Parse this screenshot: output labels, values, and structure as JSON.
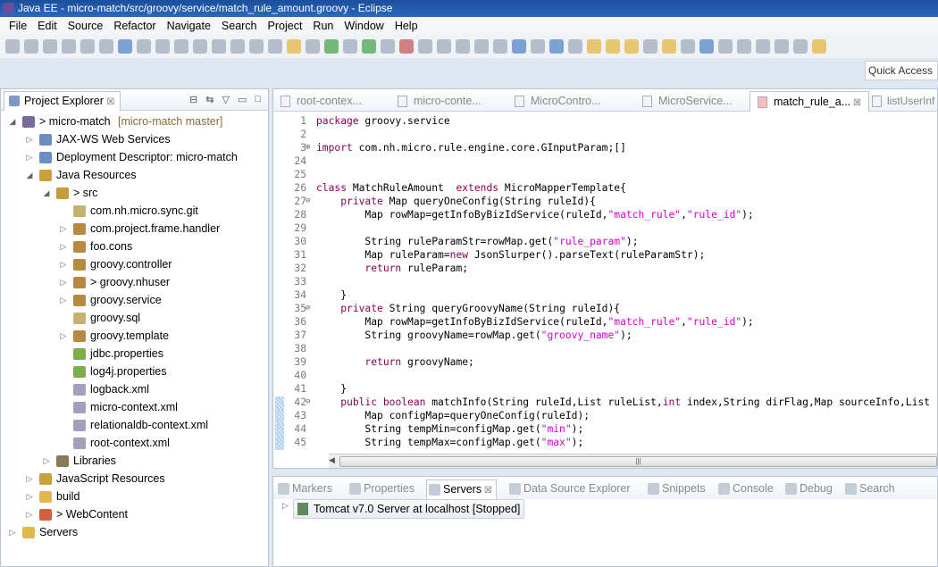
{
  "window_title": "Java EE - micro-match/src/groovy/service/match_rule_amount.groovy - Eclipse",
  "menu": [
    "File",
    "Edit",
    "Source",
    "Refactor",
    "Navigate",
    "Search",
    "Project",
    "Run",
    "Window",
    "Help"
  ],
  "quick_access": "Quick Access",
  "project_explorer": {
    "tab_label": "Project Explorer",
    "tree": [
      {
        "level": 0,
        "expanded": true,
        "label": "> micro-match",
        "decoration": "[micro-match master]",
        "icon": "project-icon",
        "color": "#7a6a9a"
      },
      {
        "level": 1,
        "expanded": false,
        "label": "JAX-WS Web Services",
        "icon": "webservice-icon",
        "color": "#6a8ec2"
      },
      {
        "level": 1,
        "expanded": false,
        "label": "Deployment Descriptor: micro-match",
        "icon": "descriptor-icon",
        "color": "#6a8ec2"
      },
      {
        "level": 1,
        "expanded": true,
        "label": "Java Resources",
        "icon": "java-resources-icon",
        "color": "#c8a040"
      },
      {
        "level": 2,
        "expanded": true,
        "label": "> src",
        "icon": "source-folder-icon",
        "color": "#c89a40"
      },
      {
        "level": 3,
        "expanded": null,
        "label": "com.nh.micro.sync.git",
        "icon": "package-icon",
        "color": "#c8b070"
      },
      {
        "level": 3,
        "expanded": false,
        "label": "com.project.frame.handler",
        "icon": "package-icon",
        "color": "#b88a40"
      },
      {
        "level": 3,
        "expanded": false,
        "label": "foo.cons",
        "icon": "package-icon",
        "color": "#b88a40"
      },
      {
        "level": 3,
        "expanded": false,
        "label": "groovy.controller",
        "icon": "package-icon",
        "color": "#b88a40"
      },
      {
        "level": 3,
        "expanded": false,
        "label": "> groovy.nhuser",
        "icon": "package-icon",
        "color": "#b88a40"
      },
      {
        "level": 3,
        "expanded": false,
        "label": "groovy.service",
        "icon": "package-icon",
        "color": "#b88a40"
      },
      {
        "level": 3,
        "expanded": null,
        "label": "groovy.sql",
        "icon": "package-icon",
        "color": "#c8b070"
      },
      {
        "level": 3,
        "expanded": false,
        "label": "groovy.template",
        "icon": "package-icon",
        "color": "#b88a40"
      },
      {
        "level": 3,
        "expanded": null,
        "label": "jdbc.properties",
        "icon": "properties-file-icon",
        "color": "#7ab04a"
      },
      {
        "level": 3,
        "expanded": null,
        "label": "log4j.properties",
        "icon": "properties-file-icon",
        "color": "#7ab04a"
      },
      {
        "level": 3,
        "expanded": null,
        "label": "logback.xml",
        "icon": "xml-file-icon",
        "color": "#a0a0b8"
      },
      {
        "level": 3,
        "expanded": null,
        "label": "micro-context.xml",
        "icon": "xml-file-icon",
        "color": "#a0a0b8"
      },
      {
        "level": 3,
        "expanded": null,
        "label": "relationaldb-context.xml",
        "icon": "xml-file-icon",
        "color": "#a0a0b8"
      },
      {
        "level": 3,
        "expanded": null,
        "label": "root-context.xml",
        "icon": "xml-file-icon",
        "color": "#a0a0b8"
      },
      {
        "level": 2,
        "expanded": false,
        "label": "Libraries",
        "icon": "libraries-icon",
        "color": "#8a7a5a"
      },
      {
        "level": 1,
        "expanded": false,
        "label": "JavaScript Resources",
        "icon": "js-resources-icon",
        "color": "#c8a040"
      },
      {
        "level": 1,
        "expanded": false,
        "label": "build",
        "icon": "folder-icon",
        "color": "#e0b850"
      },
      {
        "level": 1,
        "expanded": false,
        "label": "> WebContent",
        "icon": "webcontent-folder-icon",
        "color": "#d06040"
      },
      {
        "level": 0,
        "expanded": false,
        "label": "Servers",
        "icon": "folder-icon",
        "color": "#e0b850"
      }
    ]
  },
  "editor": {
    "tabs": [
      {
        "label": "root-contex...",
        "active": false
      },
      {
        "label": "micro-conte...",
        "active": false
      },
      {
        "label": "MicroContro...",
        "active": false
      },
      {
        "label": "MicroService...",
        "active": false
      },
      {
        "label": "match_rule_a...",
        "active": true
      },
      {
        "label": "listUserInf",
        "active": false
      }
    ],
    "lines": [
      {
        "n": "1",
        "seg": [
          [
            "kw",
            "package"
          ],
          [
            "p",
            " groovy.service"
          ]
        ]
      },
      {
        "n": "2",
        "seg": []
      },
      {
        "n": "3",
        "fold": "+",
        "seg": [
          [
            "kw",
            "import"
          ],
          [
            "p",
            " com.nh.micro.rule.engine.core.GInputParam;[]"
          ]
        ]
      },
      {
        "n": "24",
        "seg": []
      },
      {
        "n": "25",
        "seg": []
      },
      {
        "n": "26",
        "seg": [
          [
            "kw",
            "class"
          ],
          [
            "p",
            " MatchRuleAmount  "
          ],
          [
            "kw",
            "extends"
          ],
          [
            "p",
            " MicroMapperTemplate{"
          ]
        ]
      },
      {
        "n": "27",
        "fold": "-",
        "seg": [
          [
            "p",
            "    "
          ],
          [
            "kw",
            "private"
          ],
          [
            "p",
            " Map queryOneConfig(String ruleId){"
          ]
        ]
      },
      {
        "n": "28",
        "seg": [
          [
            "p",
            "        Map rowMap=getInfoByBizIdService(ruleId,"
          ],
          [
            "str",
            "\"match_rule\""
          ],
          [
            "p",
            ","
          ],
          [
            "str",
            "\"rule_id\""
          ],
          [
            "p",
            ");"
          ]
        ]
      },
      {
        "n": "29",
        "seg": []
      },
      {
        "n": "30",
        "seg": [
          [
            "p",
            "        String ruleParamStr=rowMap.get("
          ],
          [
            "str",
            "\"rule_param\""
          ],
          [
            "p",
            ");"
          ]
        ]
      },
      {
        "n": "31",
        "seg": [
          [
            "p",
            "        Map ruleParam="
          ],
          [
            "kw",
            "new"
          ],
          [
            "p",
            " JsonSlurper().parseText(ruleParamStr);"
          ]
        ]
      },
      {
        "n": "32",
        "seg": [
          [
            "p",
            "        "
          ],
          [
            "kw",
            "return"
          ],
          [
            "p",
            " ruleParam;"
          ]
        ]
      },
      {
        "n": "33",
        "seg": []
      },
      {
        "n": "34",
        "seg": [
          [
            "p",
            "    }"
          ]
        ]
      },
      {
        "n": "35",
        "fold": "-",
        "seg": [
          [
            "p",
            "    "
          ],
          [
            "kw",
            "private"
          ],
          [
            "p",
            " String queryGroovyName(String ruleId){"
          ]
        ]
      },
      {
        "n": "36",
        "seg": [
          [
            "p",
            "        Map rowMap=getInfoByBizIdService(ruleId,"
          ],
          [
            "str",
            "\"match_rule\""
          ],
          [
            "p",
            ","
          ],
          [
            "str",
            "\"rule_id\""
          ],
          [
            "p",
            ");"
          ]
        ]
      },
      {
        "n": "37",
        "seg": [
          [
            "p",
            "        String groovyName=rowMap.get("
          ],
          [
            "str",
            "\"groovy_name\""
          ],
          [
            "p",
            ");"
          ]
        ]
      },
      {
        "n": "38",
        "seg": []
      },
      {
        "n": "39",
        "seg": [
          [
            "p",
            "        "
          ],
          [
            "kw",
            "return"
          ],
          [
            "p",
            " groovyName;"
          ]
        ]
      },
      {
        "n": "40",
        "seg": []
      },
      {
        "n": "41",
        "seg": [
          [
            "p",
            "    }"
          ]
        ]
      },
      {
        "n": "42",
        "fold": "-",
        "changed": true,
        "seg": [
          [
            "p",
            "    "
          ],
          [
            "kw",
            "public"
          ],
          [
            "p",
            " "
          ],
          [
            "kw",
            "boolean"
          ],
          [
            "p",
            " matchInfo(String ruleId,List ruleList,"
          ],
          [
            "kw",
            "int"
          ],
          [
            "p",
            " index,String dirFlag,Map sourceInfo,List"
          ]
        ]
      },
      {
        "n": "43",
        "changed": true,
        "seg": [
          [
            "p",
            "        Map configMap=queryOneConfig(ruleId);"
          ]
        ]
      },
      {
        "n": "44",
        "changed": true,
        "seg": [
          [
            "p",
            "        String tempMin=configMap.get("
          ],
          [
            "str",
            "\"min\""
          ],
          [
            "p",
            ");"
          ]
        ]
      },
      {
        "n": "45",
        "changed": true,
        "seg": [
          [
            "p",
            "        String tempMax=configMap.get("
          ],
          [
            "str",
            "\"max\""
          ],
          [
            "p",
            ");"
          ]
        ]
      }
    ]
  },
  "bottom": {
    "tabs": [
      {
        "label": "Markers",
        "active": false
      },
      {
        "label": "Properties",
        "active": false
      },
      {
        "label": "Servers",
        "active": true
      },
      {
        "label": "Data Source Explorer",
        "active": false
      },
      {
        "label": "Snippets",
        "active": false
      },
      {
        "label": "Console",
        "active": false
      },
      {
        "label": "Debug",
        "active": false
      },
      {
        "label": "Search",
        "active": false
      }
    ],
    "server": "Tomcat v7.0 Server at localhost  [Stopped]"
  }
}
